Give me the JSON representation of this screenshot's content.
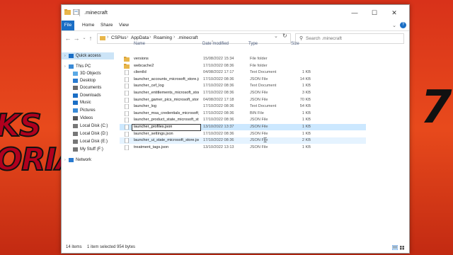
{
  "window": {
    "title": ".minecraft",
    "controls": [
      "—",
      "☐",
      "✕"
    ]
  },
  "ribbon": {
    "tabs": [
      "File",
      "Home",
      "Share",
      "View"
    ],
    "help": "?"
  },
  "address": {
    "segments": [
      "CSPlus",
      "AppData",
      "Roaming",
      ".minecraft"
    ],
    "search_placeholder": "Search .minecraft"
  },
  "sidebar": {
    "items": [
      {
        "label": "Quick access",
        "icon": "star-icon",
        "selected": true
      },
      {
        "label": "This PC",
        "icon": "computer-icon"
      },
      {
        "label": "3D Objects",
        "icon": "cube-icon"
      },
      {
        "label": "Desktop",
        "icon": "desktop-icon"
      },
      {
        "label": "Documents",
        "icon": "documents-icon"
      },
      {
        "label": "Downloads",
        "icon": "download-icon"
      },
      {
        "label": "Music",
        "icon": "music-icon"
      },
      {
        "label": "Pictures",
        "icon": "pictures-icon"
      },
      {
        "label": "Videos",
        "icon": "videos-icon"
      },
      {
        "label": "Local Disk (C:)",
        "icon": "drive-icon"
      },
      {
        "label": "Local Disk (D:)",
        "icon": "drive-icon"
      },
      {
        "label": "Local Disk (E:)",
        "icon": "drive-icon"
      },
      {
        "label": "My Stuff (F:)",
        "icon": "drive-icon"
      },
      {
        "label": "Network",
        "icon": "network-icon"
      }
    ]
  },
  "columns": [
    "Name",
    "Date modified",
    "Type",
    "Size"
  ],
  "files": [
    {
      "name": "versions",
      "date": "15/08/2022 15:34",
      "type": "File folder",
      "size": "",
      "icon": "folder-icon"
    },
    {
      "name": "webcache2",
      "date": "17/10/2022 08:36",
      "type": "File folder",
      "size": "",
      "icon": "folder-icon"
    },
    {
      "name": "clientId",
      "date": "04/08/2022 17:17",
      "type": "Text Document",
      "size": "1 KB",
      "icon": "file-icon"
    },
    {
      "name": "launcher_accounts_microsoft_store.json",
      "date": "17/10/2022 08:36",
      "type": "JSON File",
      "size": "14 KB",
      "icon": "file-icon"
    },
    {
      "name": "launcher_cef_log",
      "date": "17/10/2022 08:36",
      "type": "Text Document",
      "size": "1 KB",
      "icon": "file-icon"
    },
    {
      "name": "launcher_entitlements_microsoft_store.js...",
      "date": "17/10/2022 08:36",
      "type": "JSON File",
      "size": "3 KB",
      "icon": "file-icon"
    },
    {
      "name": "launcher_gamer_pics_microsoft_store.json",
      "date": "04/08/2022 17:18",
      "type": "JSON File",
      "size": "70 KB",
      "icon": "file-icon"
    },
    {
      "name": "launcher_log",
      "date": "17/10/2022 08:36",
      "type": "Text Document",
      "size": "54 KB",
      "icon": "file-icon"
    },
    {
      "name": "launcher_msa_credentials_microsoft_stor...",
      "date": "17/10/2022 08:36",
      "type": "BIN File",
      "size": "1 KB",
      "icon": "file-icon"
    },
    {
      "name": "launcher_product_state_microsoft_store.j...",
      "date": "17/10/2022 08:36",
      "type": "JSON File",
      "size": "1 KB",
      "icon": "file-icon"
    },
    {
      "name": "launcher_profiles.json",
      "date": "13/10/2022 13:37",
      "type": "JSON File",
      "size": "1 KB",
      "icon": "file-icon",
      "state": "renaming"
    },
    {
      "name": "launcher_settings.json",
      "date": "17/10/2022 08:36",
      "type": "JSON File",
      "size": "1 KB",
      "icon": "file-icon"
    },
    {
      "name": "launcher_ui_state_microsoft_store.json",
      "date": "17/10/2022 08:36",
      "type": "JSON File",
      "size": "2 KB",
      "icon": "file-icon",
      "state": "hover"
    },
    {
      "name": "treatment_tags.json",
      "date": "13/10/2022 13:13",
      "type": "JSON File",
      "size": "1 KB",
      "icon": "file-icon"
    }
  ],
  "status": {
    "count": "14 items",
    "selection": "1 item selected  954 bytes"
  },
  "background": {
    "line1": "KS",
    "line2": "ORIALS",
    "right": "7"
  },
  "colors": {
    "accent": "#1a6ec5",
    "folder": "#e8b64a",
    "selection": "#cce8ff",
    "background": "#e63a16"
  }
}
